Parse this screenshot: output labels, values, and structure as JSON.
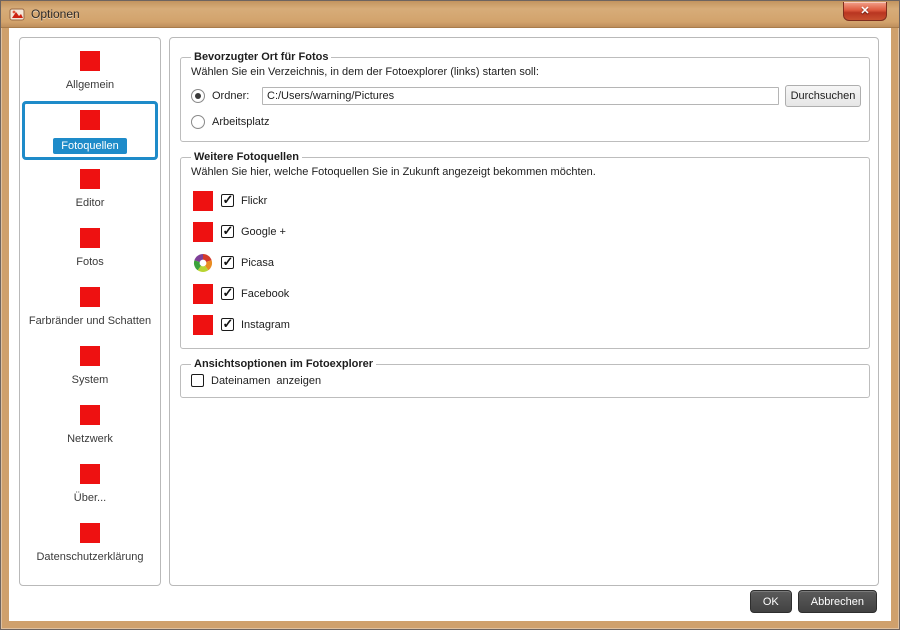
{
  "window": {
    "title": "Optionen",
    "close_glyph": "✕"
  },
  "colors": {
    "titlebar_tan": "#d0a36e",
    "accent_blue": "#1e8bc9",
    "icon_red": "#ee1111",
    "close_button_red": "#c8502f",
    "footer_button_dark": "#4a4a4a"
  },
  "sidebar": {
    "items": [
      {
        "label": "Allgemein",
        "selected": false
      },
      {
        "label": "Fotoquellen",
        "selected": true
      },
      {
        "label": "Editor",
        "selected": false
      },
      {
        "label": "Fotos",
        "selected": false
      },
      {
        "label": "Farbränder und Schatten",
        "selected": false
      },
      {
        "label": "System",
        "selected": false
      },
      {
        "label": "Netzwerk",
        "selected": false
      },
      {
        "label": "Über...",
        "selected": false
      },
      {
        "label": "Datenschutzerklärung",
        "selected": false
      }
    ]
  },
  "main": {
    "preferred_location": {
      "title": "Bevorzugter Ort für Fotos",
      "description": "Wählen Sie ein Verzeichnis, in dem der Fotoexplorer (links) starten soll:",
      "folder_radio_label": "Ordner:",
      "folder_radio_selected": true,
      "folder_path": "C:/Users/warning/Pictures",
      "browse_button_label": "Durchsuchen",
      "workspace_radio_label": "Arbeitsplatz",
      "workspace_radio_selected": false
    },
    "photo_sources": {
      "title": "Weitere Fotoquellen",
      "description": "Wählen Sie hier, welche Fotoquellen Sie in Zukunft angezeigt bekommen möchten.",
      "items": [
        {
          "label": "Flickr",
          "checked": true,
          "icon": "flickr-icon"
        },
        {
          "label": "Google +",
          "checked": true,
          "icon": "google-plus-icon"
        },
        {
          "label": "Picasa",
          "checked": true,
          "icon": "picasa-icon"
        },
        {
          "label": "Facebook",
          "checked": true,
          "icon": "facebook-icon"
        },
        {
          "label": "Instagram",
          "checked": true,
          "icon": "instagram-icon"
        }
      ]
    },
    "view_options": {
      "title": "Ansichtsoptionen im Fotoexplorer",
      "checkbox_label": "Dateinamen  anzeigen",
      "checked": false
    }
  },
  "footer": {
    "ok_label": "OK",
    "cancel_label": "Abbrechen"
  }
}
